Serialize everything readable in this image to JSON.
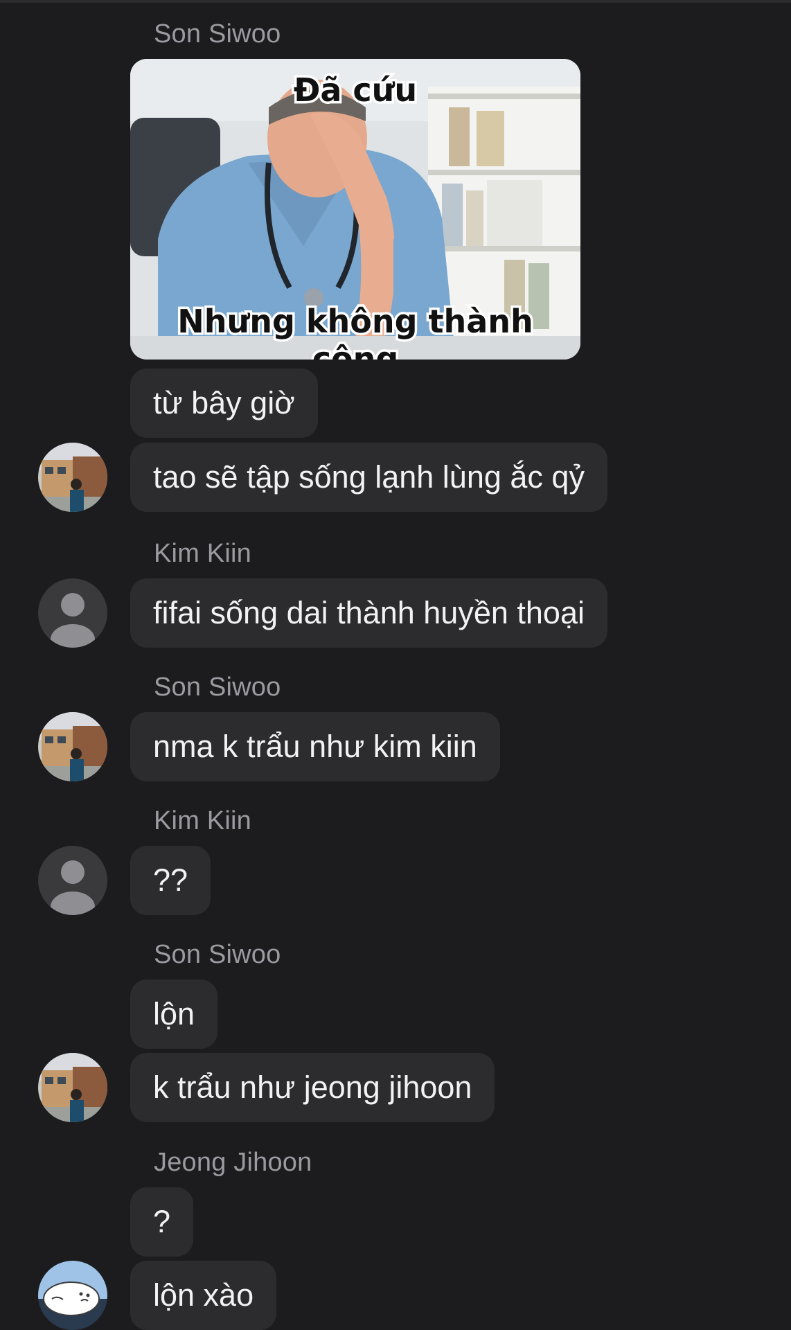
{
  "senders": {
    "s1": "Son Siwoo",
    "s2": "Kim Kiin",
    "s3": "Son Siwoo",
    "s4": "Kim Kiin",
    "s5": "Son Siwoo",
    "s6": "Jeong Jihoon"
  },
  "meme": {
    "top_text": "Đã cứu",
    "bottom_text": "Nhưng không thành công"
  },
  "messages": {
    "m1": "từ bây giờ",
    "m2": "tao sẽ tập sống lạnh lùng ắc qỷ",
    "m3": "fifai sống dai thành huyền thoại",
    "m4": "nma k trẩu như kim kiin",
    "m5": "??",
    "m6": "lộn",
    "m7": "k trẩu như jeong jihoon",
    "m8": "?",
    "m9": "lộn xào"
  },
  "colors": {
    "background": "#1c1c1e",
    "bubble": "#2c2c2e",
    "sender_name": "#9a9aa0",
    "message_text": "#f2f2f4"
  }
}
